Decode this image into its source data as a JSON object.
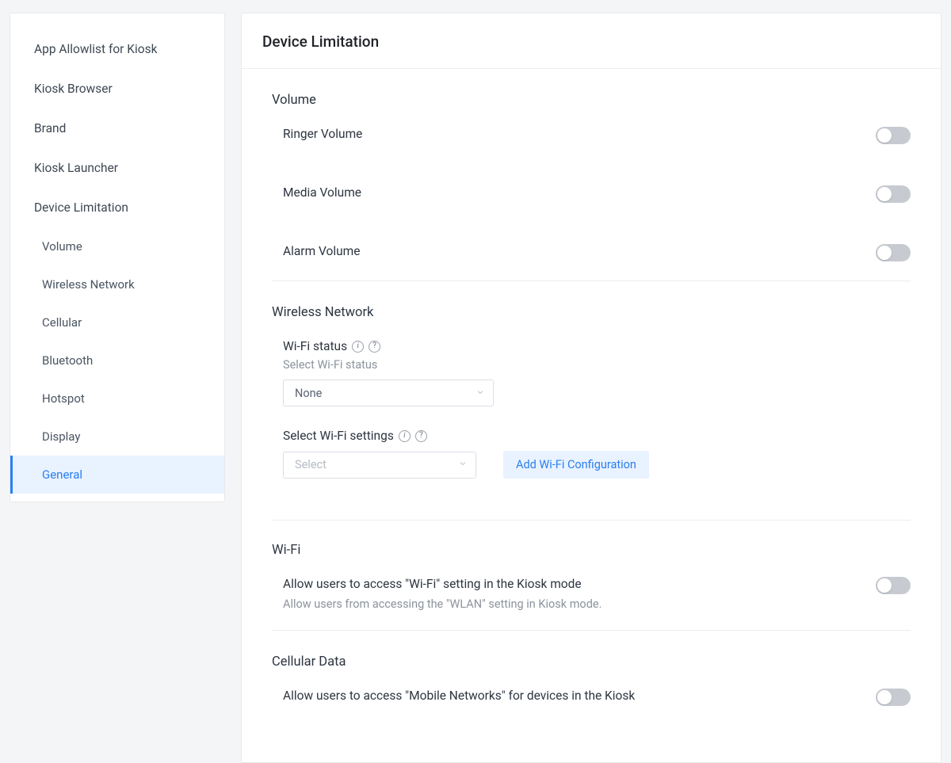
{
  "sidebar": {
    "items": [
      {
        "label": "App Allowlist for Kiosk"
      },
      {
        "label": "Kiosk Browser"
      },
      {
        "label": "Brand"
      },
      {
        "label": "Kiosk Launcher"
      },
      {
        "label": "Device Limitation"
      }
    ],
    "subitems": [
      {
        "label": "Volume"
      },
      {
        "label": "Wireless Network"
      },
      {
        "label": "Cellular"
      },
      {
        "label": "Bluetooth"
      },
      {
        "label": "Hotspot"
      },
      {
        "label": "Display"
      },
      {
        "label": "General"
      }
    ]
  },
  "main": {
    "title": "Device Limitation",
    "volume": {
      "title": "Volume",
      "ringer": "Ringer Volume",
      "media": "Media Volume",
      "alarm": "Alarm Volume"
    },
    "wireless": {
      "title": "Wireless Network",
      "status_label": "Wi-Fi status",
      "status_hint": "Select Wi-Fi status",
      "status_value": "None",
      "settings_label": "Select Wi-Fi settings",
      "settings_placeholder": "Select",
      "add_link": "Add Wi-Fi Configuration"
    },
    "wifi": {
      "title": "Wi-Fi",
      "row_label": "Allow users to access \"Wi-Fi\" setting in the Kiosk mode",
      "row_desc": "Allow users from accessing the \"WLAN\" setting in Kiosk mode."
    },
    "cellular": {
      "title": "Cellular Data",
      "row_label": "Allow users to access \"Mobile Networks\" for devices in the Kiosk"
    }
  }
}
